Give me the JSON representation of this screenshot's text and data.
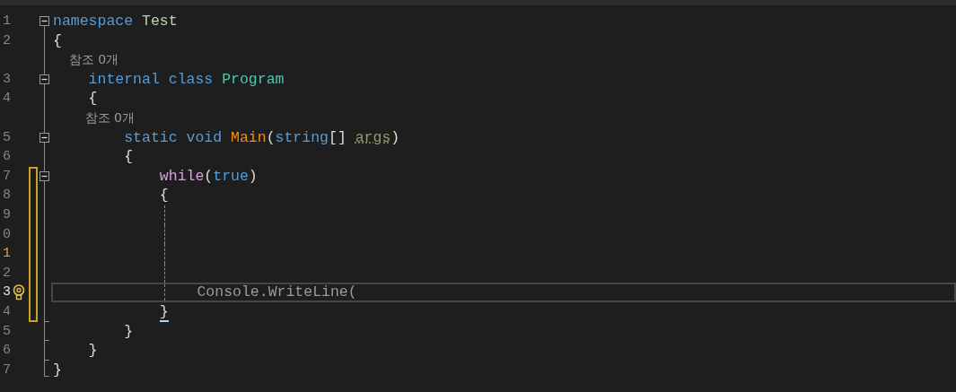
{
  "editor": {
    "lines": [
      {
        "kind": "code",
        "number": "1",
        "fold_start": true,
        "tokens": [
          {
            "text": "namespace ",
            "kind": "keyword"
          },
          {
            "text": "Test",
            "kind": "namespace"
          }
        ]
      },
      {
        "kind": "code",
        "number": "2",
        "tokens": [
          {
            "text": "{",
            "kind": "punct"
          }
        ]
      },
      {
        "kind": "codelens",
        "text": "    참조 0개"
      },
      {
        "kind": "code",
        "number": "3",
        "fold_start": true,
        "tokens": [
          {
            "text": "    internal ",
            "kind": "keyword"
          },
          {
            "text": "class ",
            "kind": "keyword"
          },
          {
            "text": "Program",
            "kind": "type"
          }
        ]
      },
      {
        "kind": "code",
        "number": "4",
        "tokens": [
          {
            "text": "    {",
            "kind": "punct"
          }
        ]
      },
      {
        "kind": "codelens",
        "text": "        참조 0개"
      },
      {
        "kind": "code",
        "number": "5",
        "fold_start": true,
        "tokens": [
          {
            "text": "        static ",
            "kind": "keyword"
          },
          {
            "text": "void ",
            "kind": "keyword"
          },
          {
            "text": "Main",
            "kind": "method"
          },
          {
            "text": "(",
            "kind": "punct"
          },
          {
            "text": "string",
            "kind": "keyword"
          },
          {
            "text": "[] ",
            "kind": "punct"
          },
          {
            "text": "args",
            "kind": "param"
          },
          {
            "text": ")",
            "kind": "punct"
          }
        ]
      },
      {
        "kind": "code",
        "number": "6",
        "tokens": [
          {
            "text": "        {",
            "kind": "punct"
          }
        ]
      },
      {
        "kind": "code",
        "number": "7",
        "fold_start": true,
        "changed": true,
        "tokens": [
          {
            "text": "            while",
            "kind": "control"
          },
          {
            "text": "(",
            "kind": "punct"
          },
          {
            "text": "true",
            "kind": "keyword"
          },
          {
            "text": ")",
            "kind": "punct"
          }
        ]
      },
      {
        "kind": "code",
        "number": "8",
        "changed": true,
        "tokens": [
          {
            "text": "            {",
            "kind": "punct"
          }
        ]
      },
      {
        "kind": "code",
        "number": "9",
        "changed": true,
        "guide": true
      },
      {
        "kind": "code",
        "number": "0",
        "changed": true,
        "guide": true
      },
      {
        "kind": "code",
        "number": "1",
        "changed": true,
        "guide": true,
        "modified": true
      },
      {
        "kind": "code",
        "number": "2",
        "changed": true,
        "guide": true
      },
      {
        "kind": "code",
        "number": "3",
        "changed": true,
        "guide": true,
        "current": true,
        "lightbulb": true,
        "tokens": [
          {
            "text": "                Console.WriteLine(",
            "kind": "dim"
          }
        ]
      },
      {
        "kind": "code",
        "number": "4",
        "fold_end": true,
        "changed": true,
        "tokens": [
          {
            "text": "            }",
            "kind": "punct",
            "matched": true
          }
        ]
      },
      {
        "kind": "code",
        "number": "5",
        "fold_end": true,
        "tokens": [
          {
            "text": "        }",
            "kind": "punct"
          }
        ]
      },
      {
        "kind": "code",
        "number": "6",
        "fold_end": true,
        "tokens": [
          {
            "text": "    }",
            "kind": "punct"
          }
        ]
      },
      {
        "kind": "code",
        "number": "7",
        "fold_end": true,
        "tokens": [
          {
            "text": "}",
            "kind": "punct"
          }
        ]
      }
    ]
  }
}
